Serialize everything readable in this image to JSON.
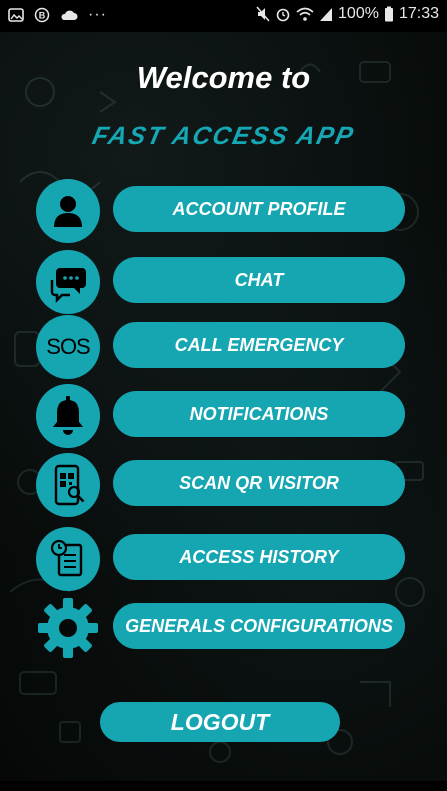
{
  "status_bar": {
    "battery_text": "100%",
    "time": "17:33",
    "dots": "···"
  },
  "header": {
    "title": "Welcome to",
    "subtitle": "FAST ACCESS APP"
  },
  "menu": {
    "items": [
      {
        "label": "ACCOUNT PROFILE"
      },
      {
        "label": "CHAT"
      },
      {
        "label": "CALL EMERGENCY",
        "icon_text": "SOS"
      },
      {
        "label": "NOTIFICATIONS"
      },
      {
        "label": "SCAN QR VISITOR"
      },
      {
        "label": "ACCESS HISTORY"
      },
      {
        "label": "GENERALS CONFIGURATIONS"
      }
    ]
  },
  "logout_label": "LOGOUT",
  "colors": {
    "accent": "#15a6b2",
    "background": "#050807"
  }
}
